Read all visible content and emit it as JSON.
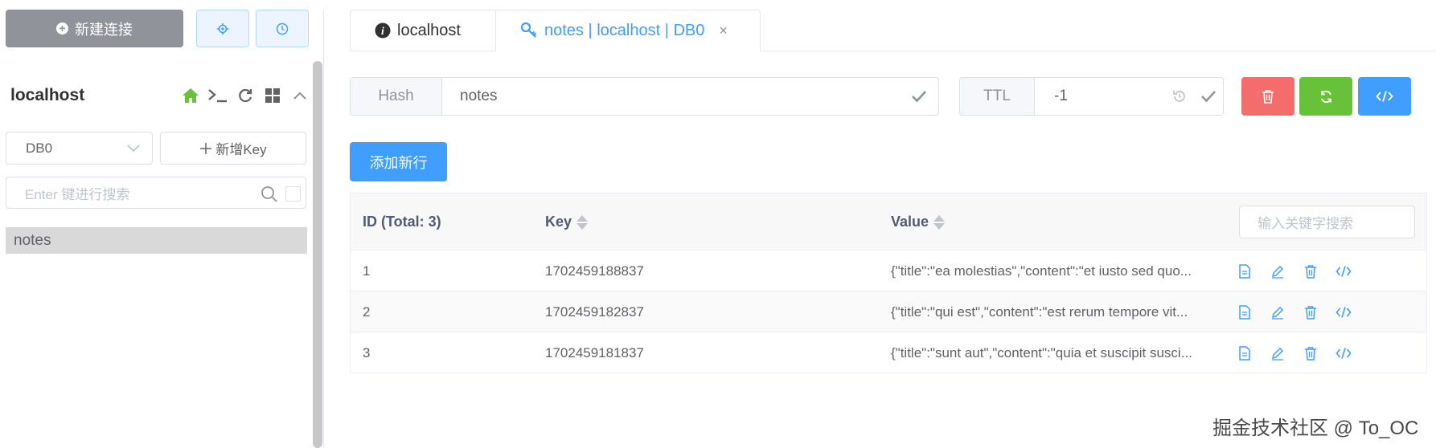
{
  "sidebar": {
    "new_connection_label": "新建连接",
    "connection_name": "localhost",
    "db_select_value": "DB0",
    "add_key_label": "新增Key",
    "search_placeholder": "Enter 键进行搜索",
    "keys": [
      "notes"
    ]
  },
  "tabs": [
    {
      "label": "localhost",
      "icon": "info-icon"
    },
    {
      "label": "notes | localhost | DB0",
      "icon": "key-icon",
      "close": "×"
    }
  ],
  "key_detail": {
    "type_label": "Hash",
    "key_name": "notes",
    "ttl_label": "TTL",
    "ttl_value": "-1",
    "add_row_label": "添加新行"
  },
  "table": {
    "headers": {
      "id": "ID (Total: 3)",
      "key": "Key",
      "value": "Value"
    },
    "search_placeholder": "输入关键字搜索",
    "rows": [
      {
        "id": "1",
        "key": "1702459188837",
        "value": "{\"title\":\"ea molestias\",\"content\":\"et iusto sed quo..."
      },
      {
        "id": "2",
        "key": "1702459182837",
        "value": "{\"title\":\"qui est\",\"content\":\"est rerum tempore vit..."
      },
      {
        "id": "3",
        "key": "1702459181837",
        "value": "{\"title\":\"sunt aut\",\"content\":\"quia et suscipit susci..."
      }
    ]
  },
  "watermark": "掘金技术社区 @ To_OC",
  "colors": {
    "primary": "#409eff",
    "danger": "#f56c6c",
    "success": "#67c23a",
    "info": "#909399",
    "home_icon": "#67c23a"
  }
}
